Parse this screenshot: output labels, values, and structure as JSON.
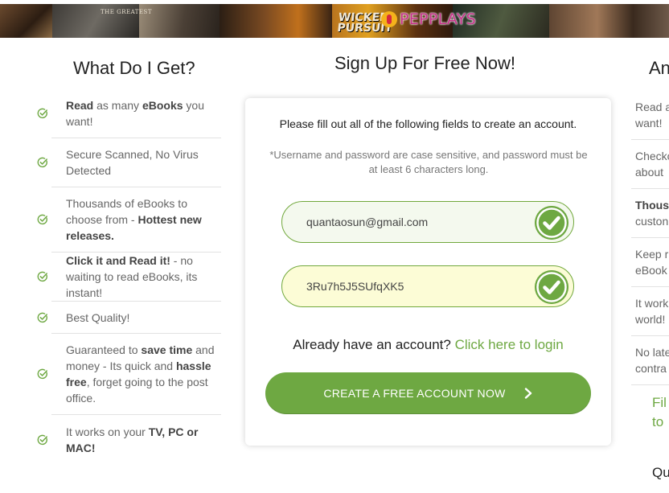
{
  "banner": {
    "movie_title": "THE GREATEST",
    "poster_text": "WICKED PURSUIT",
    "brand_name": "PEPPLAYS"
  },
  "left_column": {
    "title": "What Do I Get?",
    "items": [
      {
        "parts": [
          {
            "b": "Read"
          },
          {
            "t": " as many "
          },
          {
            "b": "eBooks"
          },
          {
            "t": " you want!"
          }
        ]
      },
      {
        "parts": [
          {
            "t": "Secure Scanned, No Virus Detected"
          }
        ]
      },
      {
        "parts": [
          {
            "t": "Thousands of eBooks to choose from - "
          },
          {
            "b": "Hottest new releases."
          }
        ]
      },
      {
        "parts": [
          {
            "b": "Click it and Read it!"
          },
          {
            "t": " - no waiting to read eBooks, its instant!"
          }
        ]
      },
      {
        "parts": [
          {
            "t": "Best Quality!"
          }
        ]
      },
      {
        "parts": [
          {
            "t": "Guaranteed to "
          },
          {
            "b": "save time"
          },
          {
            "t": " and money - Its quick and "
          },
          {
            "b": "hassle free"
          },
          {
            "t": ", forget going to the post office."
          }
        ]
      },
      {
        "parts": [
          {
            "t": "It works on your "
          },
          {
            "b": "TV, PC or MAC!"
          }
        ]
      }
    ]
  },
  "signup": {
    "title": "Sign Up For Free Now!",
    "instructions": "Please fill out all of the following fields to create an account.",
    "note": "*Username and password are case sensitive, and password must be at least 6 characters long.",
    "email_value": "quantaosun@gmail.com",
    "password_value": "3Ru7h5J5SUfqXK5",
    "login_prompt": "Already have an account?",
    "login_link": "Click here to login",
    "create_button": "CREATE A FREE ACCOUNT NOW"
  },
  "right_column": {
    "title_fragment": "An",
    "item_fragments": [
      [
        "Read a",
        "want!"
      ],
      [
        "Checko",
        "about"
      ],
      [
        "Thous",
        "custon"
      ],
      [
        "Keep r",
        "eBook"
      ],
      [
        "It work",
        "world!"
      ],
      [
        "No late",
        "contra"
      ]
    ],
    "cta_fragment": [
      "Fil",
      "to"
    ],
    "bottom_fragment": "Qu"
  },
  "colors": {
    "accent_green": "#6ea842",
    "brand_pink": "#c8318a",
    "password_bg": "#fcfcd6"
  },
  "icons": {
    "feature_bullet": "check-circle-icon",
    "field_valid": "checkmark-badge-icon",
    "button_arrow": "chevron-right-icon"
  }
}
